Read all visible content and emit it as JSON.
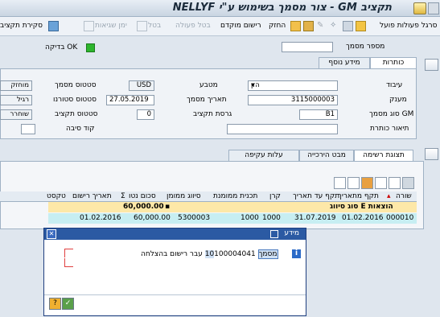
{
  "window": {
    "title": "תקציב GM - צור מסמך בשימוש ע\"י NELLYF"
  },
  "toolbar": {
    "items": [
      "סרגל פעולות פועל",
      "סקירת תקציב",
      "ימן שגיאות",
      "בטל",
      "בטל פעולה",
      "רישום מוקדם",
      "החזק"
    ],
    "disabled": [
      "ימן שגיאות",
      "בטל",
      "בטל פעולה"
    ]
  },
  "header": {
    "doc_no_label": "מספר מסמך",
    "check_label": "בדיקה OK",
    "check_color": "#2db52d"
  },
  "tabs": {
    "titles": "כותרות",
    "more_info": "מידע נוסף"
  },
  "form": {
    "process_label": "עיבוד",
    "process_value": "הזן",
    "currency_label": "מטבע",
    "currency_value": "USD",
    "doc_status_label": "סטטוס מסמך",
    "doc_status_value": "מוחזק",
    "range_label": "מענק",
    "range_value": "3115000003",
    "doc_date_label": "תאריך מסמך",
    "doc_date_value": "27.05.2019",
    "wf_status_label": "סטטוס סטורנו",
    "wf_status_value": "רגיל",
    "gm_type_label": "סוג מסמך GM",
    "gm_type_value": "B1",
    "budget_ver_label": "גרסת תקציב",
    "budget_ver_value": "0",
    "budget_status_label": "סטטוס תקציב",
    "budget_status_value": "שוחרר",
    "header_desc_label": "תיאור כותרת",
    "reason_label": "קוד סיבה"
  },
  "lower_tabs": {
    "entry_view": "תצוגת רשימה",
    "hierarchy": "מבט הירכייה",
    "overhead": "עלות עקיפה"
  },
  "grid": {
    "columns": [
      "שורה",
      "תקף מתאריך",
      "תקף עד תאריך",
      "קרן",
      "תכנית ממומנת",
      "סיווג ממומן",
      "סכום נטו",
      "תאריך רישום",
      "טקסט"
    ],
    "group_label": "סוג סיווג E הוצאות",
    "group_total": "60,000.00",
    "rows": [
      {
        "line": "000010",
        "from": "01.02.2016",
        "to": "31.07.2019",
        "fund": "1000",
        "program": "1000",
        "class": "5300003",
        "amount": "60,000.00",
        "post_date": "01.02.2016",
        "text": ""
      }
    ]
  },
  "dialog": {
    "title": "מידע",
    "message_prefix": "מסמך",
    "message_highlight": "10",
    "message_number": "100004041",
    "message_suffix": "עבר רישום בהצלחה"
  }
}
